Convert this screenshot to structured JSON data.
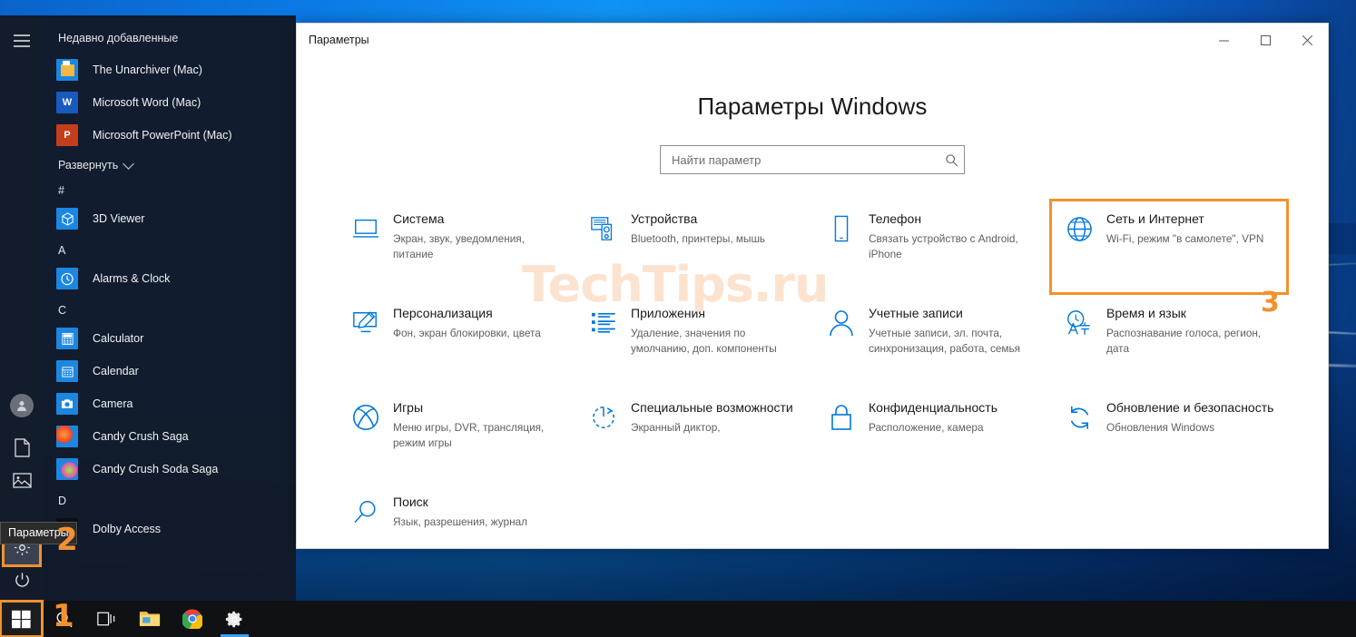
{
  "start_menu": {
    "recently_added_header": "Недавно добавленные",
    "recent_apps": [
      {
        "name": "The Unarchiver (Mac)",
        "icon": "unarchiver-icon"
      },
      {
        "name": "Microsoft Word (Mac)",
        "icon": "word-icon",
        "letter": "W"
      },
      {
        "name": "Microsoft PowerPoint (Mac)",
        "icon": "powerpoint-icon",
        "letter": "P"
      }
    ],
    "expand_label": "Развернуть",
    "groups": [
      {
        "letter": "#",
        "apps": [
          {
            "name": "3D Viewer",
            "icon": "cube-icon"
          }
        ]
      },
      {
        "letter": "A",
        "apps": [
          {
            "name": "Alarms & Clock",
            "icon": "clock-icon"
          }
        ]
      },
      {
        "letter": "C",
        "apps": [
          {
            "name": "Calculator",
            "icon": "calculator-icon"
          },
          {
            "name": "Calendar",
            "icon": "calendar-icon"
          },
          {
            "name": "Camera",
            "icon": "camera-icon"
          },
          {
            "name": "Candy Crush Saga",
            "icon": "candy-crush-icon"
          },
          {
            "name": "Candy Crush Soda Saga",
            "icon": "candy-crush-soda-icon"
          }
        ]
      },
      {
        "letter": "D",
        "apps": [
          {
            "name": "Dolby Access",
            "icon": "dolby-icon"
          }
        ]
      }
    ],
    "rail": {
      "hamburger": "hamburger-icon",
      "user": "user-avatar-icon",
      "documents": "documents-icon",
      "pictures": "pictures-icon",
      "settings": "gear-icon",
      "power": "power-icon"
    },
    "settings_tooltip": "Параметры"
  },
  "settings_window": {
    "titlebar_title": "Параметры",
    "controls": {
      "minimize": "minimize-icon",
      "maximize": "maximize-icon",
      "close": "close-icon"
    },
    "heading": "Параметры Windows",
    "search": {
      "placeholder": "Найти параметр",
      "value": "",
      "icon": "search-icon"
    },
    "categories": [
      {
        "title": "Система",
        "desc": "Экран, звук, уведомления, питание",
        "icon": "laptop-icon",
        "highlighted": false
      },
      {
        "title": "Устройства",
        "desc": "Bluetooth, принтеры, мышь",
        "icon": "devices-icon",
        "highlighted": false
      },
      {
        "title": "Телефон",
        "desc": "Связать устройство с Android, iPhone",
        "icon": "phone-icon",
        "highlighted": false
      },
      {
        "title": "Сеть и Интернет",
        "desc": "Wi-Fi, режим \"в самолете\", VPN",
        "icon": "globe-icon",
        "highlighted": true
      },
      {
        "title": "Персонализация",
        "desc": "Фон, экран блокировки, цвета",
        "icon": "personalization-icon",
        "highlighted": false
      },
      {
        "title": "Приложения",
        "desc": "Удаление, значения по умолчанию, доп. компоненты",
        "icon": "apps-list-icon",
        "highlighted": false
      },
      {
        "title": "Учетные записи",
        "desc": "Учетные записи, эл. почта, синхронизация, работа, семья",
        "icon": "account-icon",
        "highlighted": false
      },
      {
        "title": "Время и язык",
        "desc": "Распознавание голоса, регион, дата",
        "icon": "time-language-icon",
        "highlighted": false
      },
      {
        "title": "Игры",
        "desc": "Меню игры, DVR, трансляция, режим игры",
        "icon": "xbox-icon",
        "highlighted": false
      },
      {
        "title": "Специальные возможности",
        "desc": "Экранный диктор,",
        "icon": "accessibility-icon",
        "highlighted": false
      },
      {
        "title": "Конфиденциальность",
        "desc": "Расположение, камера",
        "icon": "lock-icon",
        "highlighted": false
      },
      {
        "title": "Обновление и безопасность",
        "desc": "Обновления Windows",
        "icon": "update-icon",
        "highlighted": false
      },
      {
        "title": "Поиск",
        "desc": "Язык, разрешения, журнал",
        "icon": "magnifier-icon",
        "highlighted": false
      }
    ]
  },
  "taskbar": {
    "items": [
      {
        "name": "start-button",
        "icon": "windows-logo-icon",
        "active": false,
        "highlighted": true
      },
      {
        "name": "search-button",
        "icon": "search-icon",
        "active": false,
        "highlighted": false
      },
      {
        "name": "task-view-button",
        "icon": "task-view-icon",
        "active": false,
        "highlighted": false
      },
      {
        "name": "file-explorer-button",
        "icon": "folder-icon",
        "active": false,
        "highlighted": false
      },
      {
        "name": "chrome-button",
        "icon": "chrome-icon",
        "active": false,
        "highlighted": false
      },
      {
        "name": "settings-taskbar-button",
        "icon": "gear-icon",
        "active": true,
        "highlighted": false
      }
    ]
  },
  "annotations": {
    "step1": "1",
    "step2": "2",
    "step3": "3",
    "color": "#f2912e"
  },
  "watermark": {
    "text": "TechTips.ru",
    "color": "#fbe3d0"
  },
  "colors": {
    "accent": "#0078d7",
    "highlight": "#f2912e",
    "start_menu_bg": "#121a28",
    "taskbar_bg": "#101114"
  }
}
